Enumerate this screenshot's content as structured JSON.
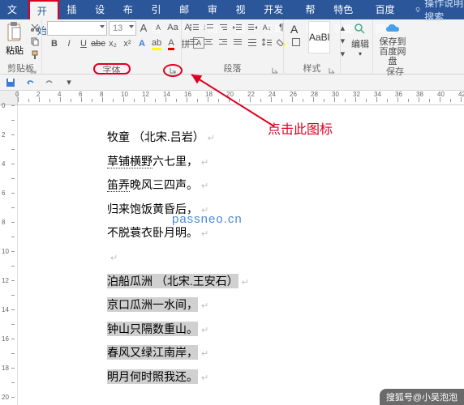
{
  "tabs": {
    "file": "文件",
    "home": "开始",
    "insert": "插入",
    "design": "设计",
    "layout": "布局",
    "references": "引用",
    "mailings": "邮件",
    "review": "审阅",
    "view": "视图",
    "devtools": "开发工具",
    "help": "帮助",
    "special": "特色功能",
    "baidu": "百度网盘",
    "tellme": "操作说明搜索"
  },
  "ribbon": {
    "paste": "粘贴",
    "clipboard_label": "剪贴板",
    "font_size": "13",
    "font_label": "字体",
    "paragraph_label": "段落",
    "styles_label": "样式",
    "style_preview": "AaBl",
    "editing": "编辑",
    "save_baidu": "保存到\n百度网盘",
    "save_label": "保存"
  },
  "annotation": {
    "arrow_text": "点击此图标"
  },
  "watermark": "passneo.cn",
  "document": {
    "poem1_title": "牧童   （北宋.吕岩）",
    "poem1_l1a": "草铺横野",
    "poem1_l1b": "六七里，",
    "poem1_l2a": "笛弄",
    "poem1_l2b": "晚风三四声。",
    "poem1_l3": "归来饱饭黄昏后，",
    "poem1_l4": "不脱蓑衣卧月明。",
    "poem2_title": "泊船瓜洲   （北宋.王安石）",
    "poem2_l1": "京口瓜洲一水间，",
    "poem2_l2": "钟山只隔数重山。",
    "poem2_l3": "春风又绿江南岸，",
    "poem2_l4": "明月何时照我还。"
  },
  "footer": "搜狐号@小吴泡泡"
}
